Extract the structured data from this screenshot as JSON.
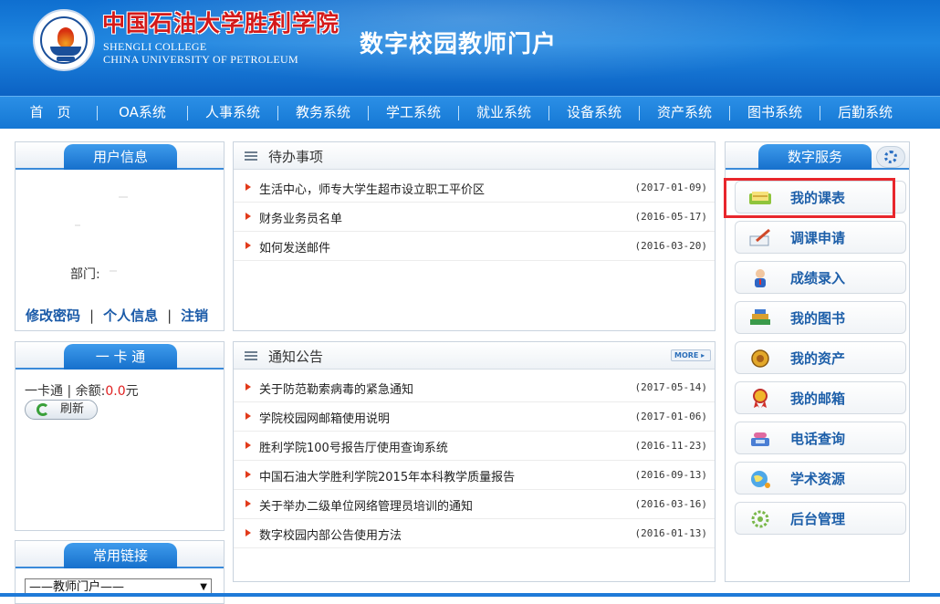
{
  "header": {
    "college_cn": "中国石油大学胜利学院",
    "college_en_line1": "SHENGLI COLLEGE",
    "college_en_line2": "CHINA UNIVERSITY OF PETROLEUM",
    "portal_title": "数字校园教师门户"
  },
  "nav": [
    {
      "label": "首　页"
    },
    {
      "label": "OA系统"
    },
    {
      "label": "人事系统"
    },
    {
      "label": "教务系统"
    },
    {
      "label": "学工系统"
    },
    {
      "label": "就业系统"
    },
    {
      "label": "设备系统"
    },
    {
      "label": "资产系统"
    },
    {
      "label": "图书系统"
    },
    {
      "label": "后勤系统"
    }
  ],
  "user_panel": {
    "title": "用户信息",
    "dept_label": "部门:",
    "links": [
      "修改密码",
      "个人信息",
      "注销"
    ],
    "separator": "|"
  },
  "card_panel": {
    "title": "一 卡 通",
    "label": "一卡通 | 余额:",
    "balance": "0.0",
    "unit": "元",
    "refresh_label": "刷新"
  },
  "links_panel": {
    "title": "常用链接",
    "select_value": "——教师门户——"
  },
  "todo": {
    "title": "待办事项",
    "items": [
      {
        "title": "生活中心，师专大学生超市设立职工平价区",
        "date": "(2017-01-09)"
      },
      {
        "title": "财务业务员名单",
        "date": "(2016-05-17)"
      },
      {
        "title": "如何发送邮件",
        "date": "(2016-03-20)"
      }
    ]
  },
  "notices": {
    "title": "通知公告",
    "more_label": "MORE ▸",
    "items": [
      {
        "title": "关于防范勒索病毒的紧急通知",
        "date": "(2017-05-14)"
      },
      {
        "title": "学院校园网邮箱使用说明",
        "date": "(2017-01-06)"
      },
      {
        "title": "胜利学院100号报告厅使用查询系统",
        "date": "(2016-11-23)"
      },
      {
        "title": "中国石油大学胜利学院2015年本科教学质量报告",
        "date": "(2016-09-13)"
      },
      {
        "title": "关于举办二级单位网络管理员培训的通知",
        "date": "(2016-03-16)"
      },
      {
        "title": "数字校园内部公告使用方法",
        "date": "(2016-01-13)"
      }
    ]
  },
  "services": {
    "title": "数字服务",
    "items": [
      {
        "label": "我的课表",
        "icon": "book-icon"
      },
      {
        "label": "调课申请",
        "icon": "pen-paper-icon"
      },
      {
        "label": "成绩录入",
        "icon": "person-icon"
      },
      {
        "label": "我的图书",
        "icon": "books-icon"
      },
      {
        "label": "我的资产",
        "icon": "coins-icon"
      },
      {
        "label": "我的邮箱",
        "icon": "ribbon-icon"
      },
      {
        "label": "电话查询",
        "icon": "phone-icon"
      },
      {
        "label": "学术资源",
        "icon": "globe-icon"
      },
      {
        "label": "后台管理",
        "icon": "gear-icon"
      }
    ]
  },
  "colors": {
    "brand_blue": "#1477d4",
    "link_blue": "#1d5fa9",
    "highlight_red": "#e8262c",
    "bullet_red": "#e23a1a"
  }
}
